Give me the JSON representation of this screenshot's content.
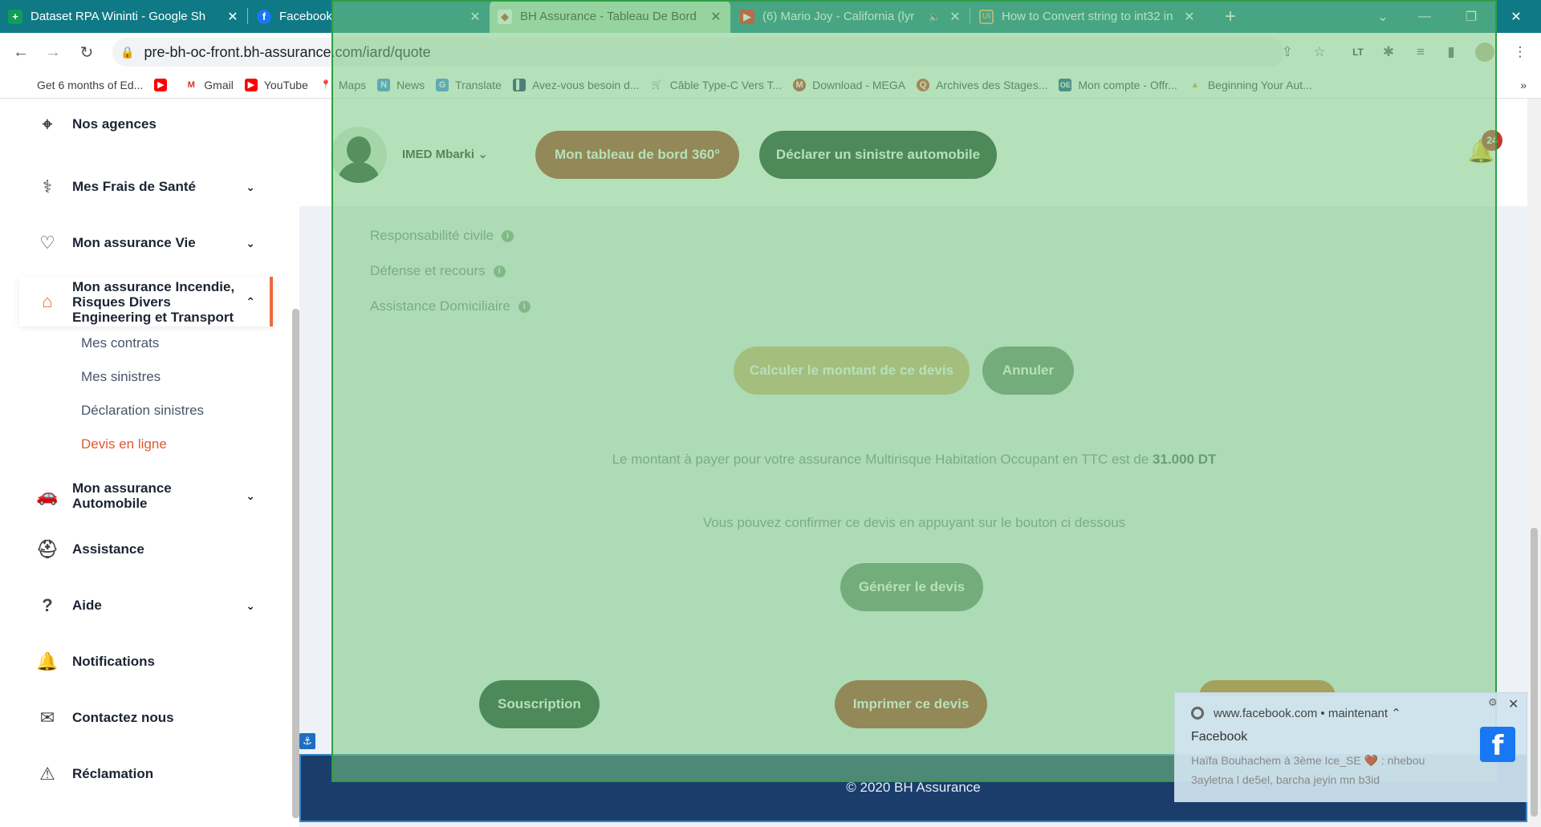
{
  "browser": {
    "tabs": [
      {
        "title": "Dataset RPA Wininti - Google Sh",
        "icon": "sheets-icon"
      },
      {
        "title": "Facebook",
        "icon": "facebook-icon"
      },
      {
        "title": "BH Assurance - Tableau De Bord",
        "icon": "bh-icon"
      },
      {
        "title": "(6) Mario Joy - California (lyr",
        "icon": "youtube-icon"
      },
      {
        "title": "How to Convert string to int32 in",
        "icon": "ui-icon"
      }
    ],
    "url": "pre-bh-oc-front.bh-assurance.com/iard/quote",
    "bookmarks": [
      "Get 6 months of Ed...",
      "",
      "Gmail",
      "YouTube",
      "Maps",
      "News",
      "Translate",
      "Avez-vous besoin d...",
      "Câble Type-C Vers T...",
      "Download - MEGA",
      "Archives des Stages...",
      "Mon compte - Offr...",
      "Beginning Your Aut..."
    ]
  },
  "sidebar": {
    "items": [
      {
        "label": "Nos agences"
      },
      {
        "label": "Mes Frais de Santé"
      },
      {
        "label": "Mon assurance Vie"
      },
      {
        "label": "Mon assurance Incendie, Risques Divers Engineering et Transport"
      },
      {
        "label": "Mon assurance Automobile"
      },
      {
        "label": "Assistance"
      },
      {
        "label": "Aide"
      },
      {
        "label": "Notifications"
      },
      {
        "label": "Contactez nous"
      },
      {
        "label": "Réclamation"
      }
    ],
    "subitems": [
      "Mes contrats",
      "Mes sinistres",
      "Déclaration sinistres",
      "Devis en ligne"
    ]
  },
  "header": {
    "user": "IMED Mbarki",
    "dashboard_button": "Mon tableau de bord 360°",
    "declare_button": "Déclarer un sinistre automobile",
    "notif_count": "24"
  },
  "coverages": [
    "Responsabilité civile",
    "Défense et recours",
    "Assistance Domiciliaire"
  ],
  "actions": {
    "calculate": "Calculer le montant de ce devis",
    "cancel": "Annuler",
    "generate": "Générer le devis",
    "subscribe": "Souscription",
    "print": "Imprimer ce devis"
  },
  "result": {
    "text": "Le montant à payer pour votre assurance Multirisque Habitation Occupant en TTC est de",
    "amount": "31.000 DT",
    "confirm": "Vous pouvez confirmer ce devis en appuyant sur le bouton ci dessous"
  },
  "footer": {
    "copyright": "© 2020 BH Assurance"
  },
  "notification": {
    "source": "www.facebook.com",
    "time": "maintenant",
    "title": "Facebook",
    "text": "Haïfa Bouhachem à 3ème Ice_SE 🤎 : nhebou 3ayletna l de5el, barcha jeyin mn b3id"
  },
  "colors": {
    "accent": "#ec6a3d",
    "red_button": "#b33a24",
    "dark_green": "#1b3d2b",
    "footer": "#1b3d6b"
  }
}
